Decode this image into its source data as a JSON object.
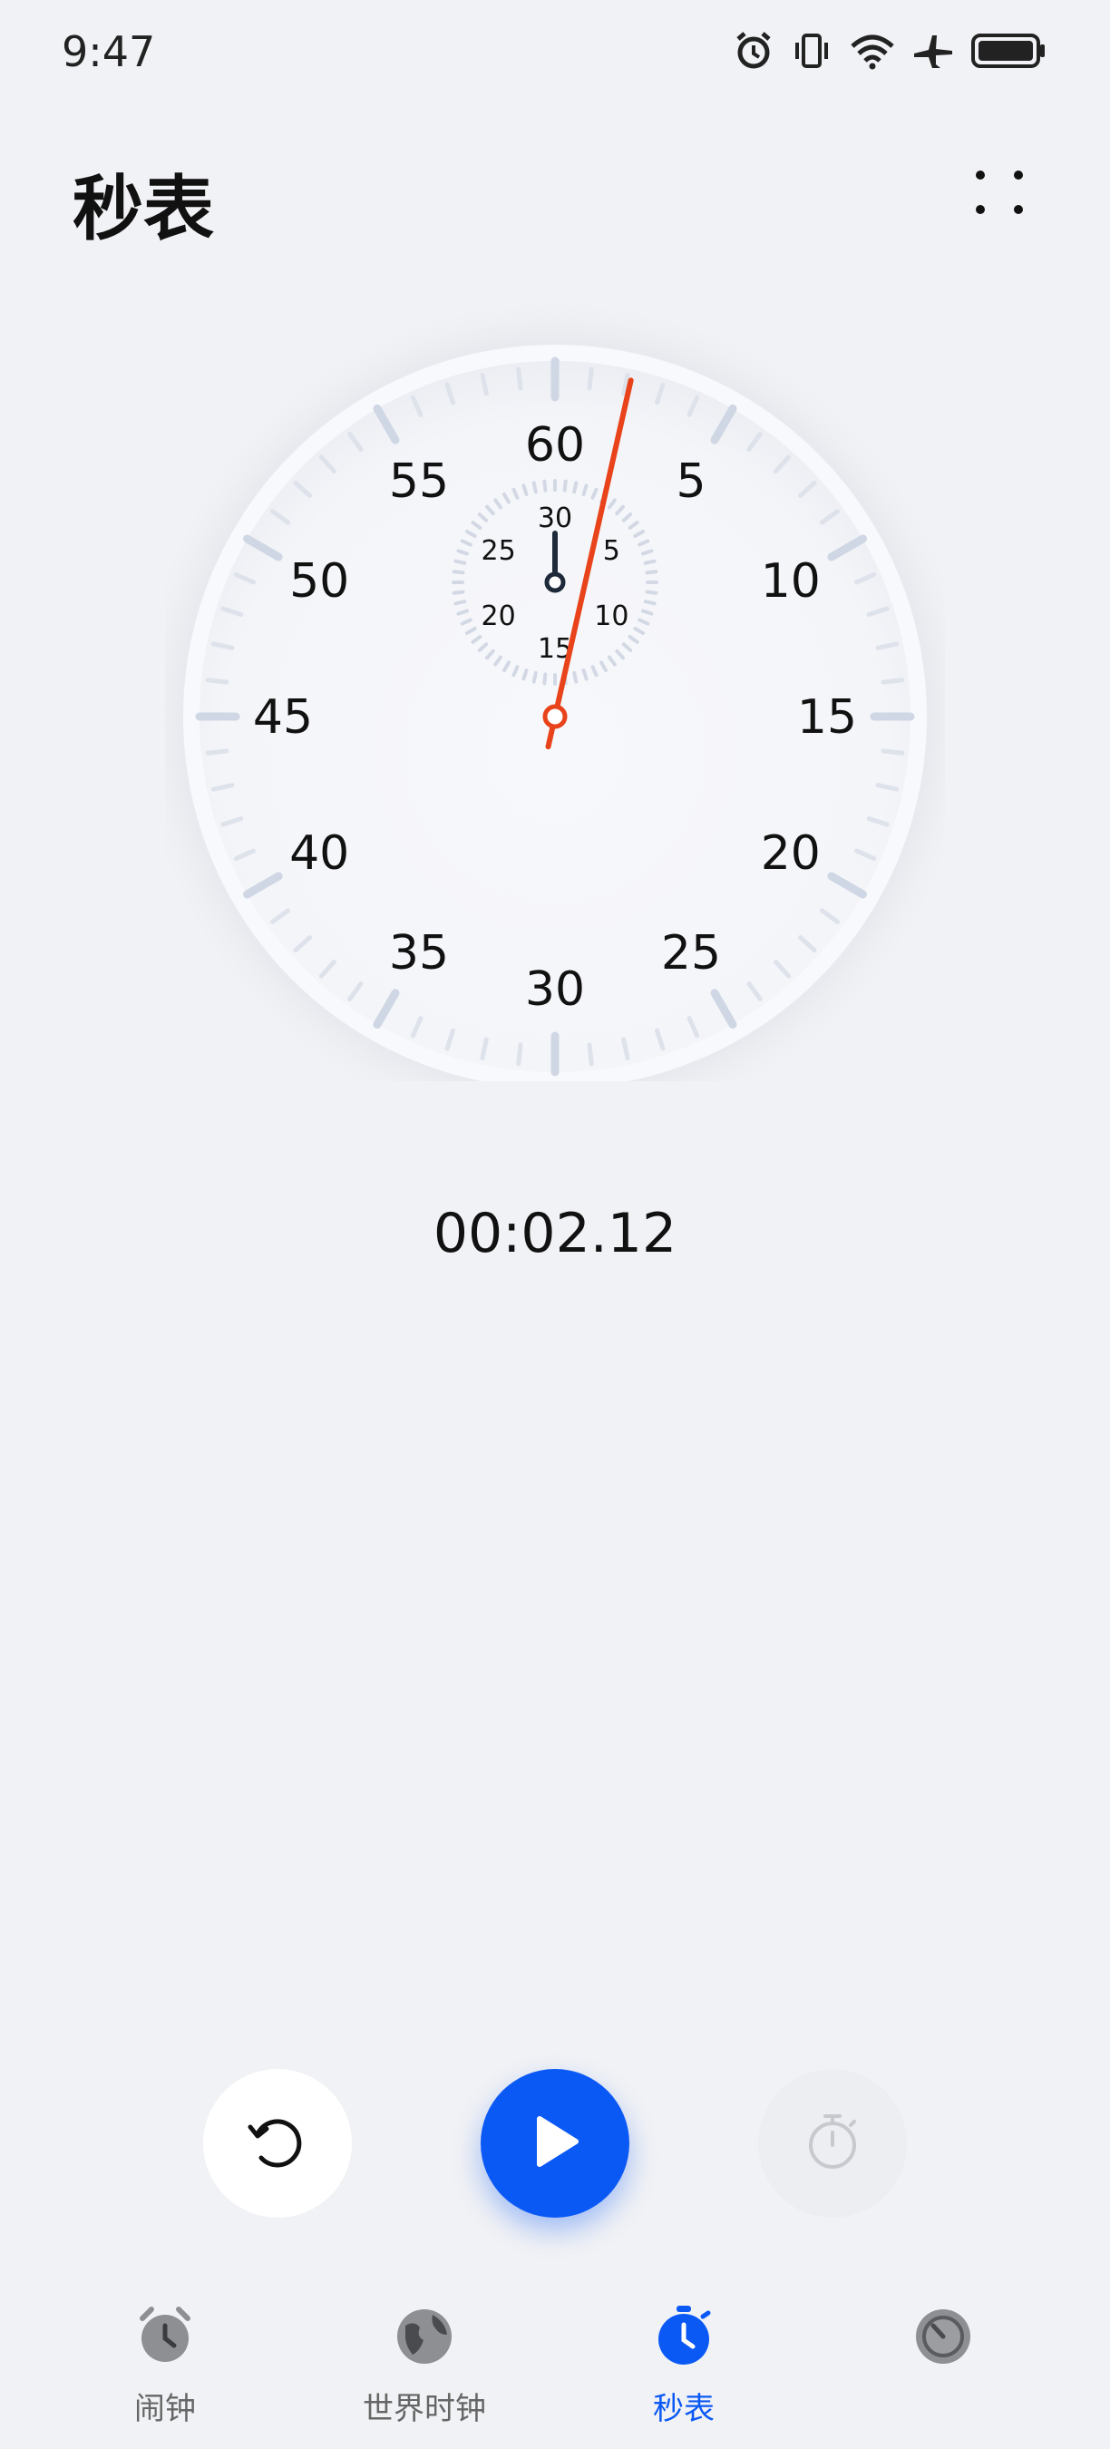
{
  "status_bar": {
    "time": "9:47",
    "icons": [
      "alarm-icon",
      "vibrate-icon",
      "wifi-icon",
      "airplane-icon",
      "battery-icon"
    ]
  },
  "header": {
    "title": "秒表",
    "menu_icon": "more-icon"
  },
  "dial": {
    "outer_labels": [
      "60",
      "5",
      "10",
      "15",
      "20",
      "25",
      "30",
      "35",
      "40",
      "45",
      "50",
      "55"
    ],
    "inner_labels": [
      "30",
      "5",
      "10",
      "15",
      "20",
      "25"
    ],
    "second_hand_seconds": 2.12,
    "minute_hand_minutes": 0,
    "hand_color": "#e8431a"
  },
  "elapsed": {
    "time": "00:02.12"
  },
  "controls": {
    "reset_icon": "reset-icon",
    "play_icon": "play-icon",
    "lap_icon": "lap-timer-icon",
    "accent_color": "#0b59f5"
  },
  "tabs": [
    {
      "label": "闹钟",
      "icon": "alarm-clock-icon",
      "active": false
    },
    {
      "label": "世界时钟",
      "icon": "globe-icon",
      "active": false
    },
    {
      "label": "秒表",
      "icon": "stopwatch-icon",
      "active": true
    },
    {
      "label": "",
      "icon": "timer-icon",
      "active": false
    }
  ]
}
